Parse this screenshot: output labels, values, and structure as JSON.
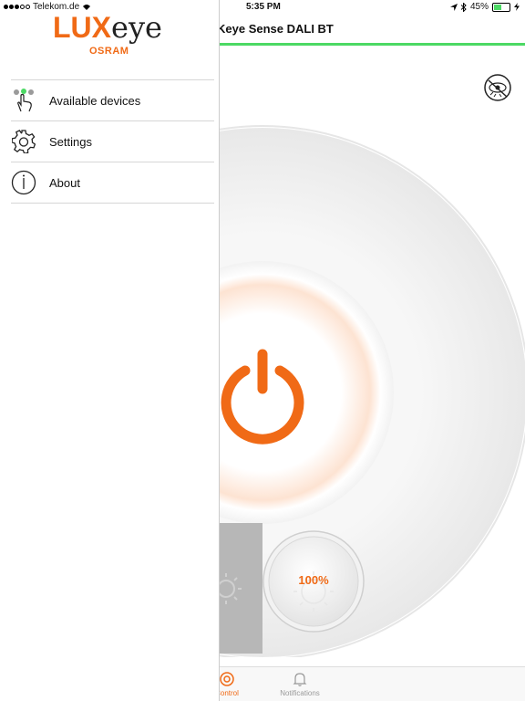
{
  "status_bar": {
    "carrier": "Telekom.de",
    "time": "5:35 PM",
    "battery": "45%",
    "battery_level": 0.45
  },
  "drawer": {
    "logo": {
      "brand_part1": "LUX",
      "brand_part2": "eye",
      "maker": "OSRAM"
    },
    "menu": [
      {
        "label": "Available devices",
        "icon": "devices-touch-icon"
      },
      {
        "label": "Settings",
        "icon": "gear-icon"
      },
      {
        "label": "About",
        "icon": "info-icon"
      }
    ]
  },
  "main": {
    "title": "Keye Sense DALI BT",
    "brightness": "100%",
    "tabs": [
      {
        "label": "Control",
        "icon": "control-icon",
        "active": true
      },
      {
        "label": "Notifications",
        "icon": "bell-icon",
        "active": false
      }
    ]
  },
  "colors": {
    "accent": "#f06a16",
    "connected_green": "#4cd964"
  }
}
